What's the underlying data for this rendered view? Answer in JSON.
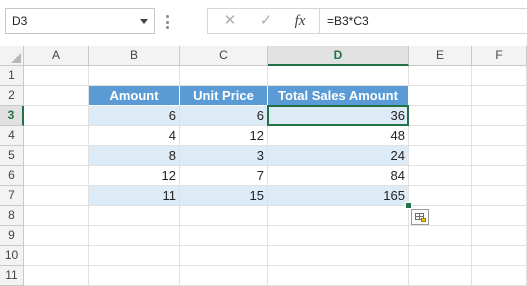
{
  "name_box": {
    "value": "D3"
  },
  "formula_bar": {
    "cancel_icon": "✕",
    "enter_icon": "✓",
    "fx_icon": "fx",
    "formula": "=B3*C3"
  },
  "columns": [
    "A",
    "B",
    "C",
    "D",
    "E",
    "F"
  ],
  "rows": [
    "1",
    "2",
    "3",
    "4",
    "5",
    "6",
    "7",
    "8",
    "9",
    "10",
    "11"
  ],
  "active_cell": {
    "column": "D",
    "row": "3"
  },
  "table": {
    "headers": [
      "Amount",
      "Unit Price",
      "Total Sales Amount"
    ],
    "rows": [
      [
        "6",
        "6",
        "36"
      ],
      [
        "4",
        "12",
        "48"
      ],
      [
        "8",
        "3",
        "24"
      ],
      [
        "12",
        "7",
        "84"
      ],
      [
        "11",
        "15",
        "165"
      ]
    ]
  },
  "colors": {
    "header_fill": "#5b9bd5",
    "band_fill": "#ddebf7",
    "selection": "#217346"
  },
  "icons": {
    "quick_analysis": "quick-analysis-icon",
    "name_box_dropdown": "chevron-down-icon"
  }
}
